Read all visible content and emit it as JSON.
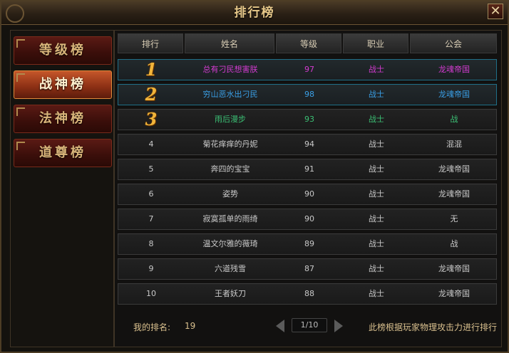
{
  "window": {
    "title": "排行榜",
    "close_label": "✕"
  },
  "sidebar": {
    "items": [
      {
        "label": "等级榜",
        "active": false
      },
      {
        "label": "战神榜",
        "active": true
      },
      {
        "label": "法神榜",
        "active": false
      },
      {
        "label": "道尊榜",
        "active": false
      }
    ]
  },
  "table": {
    "headers": [
      "排行",
      "姓名",
      "等级",
      "职业",
      "公会"
    ],
    "rows": [
      {
        "rank": "1",
        "name": "总有刁民想害朕",
        "level": "97",
        "class": "战士",
        "guild": "龙魂帝国",
        "color": "#d33bd0",
        "selected": true
      },
      {
        "rank": "2",
        "name": "穷山恶水出刁民",
        "level": "98",
        "class": "战士",
        "guild": "龙魂帝国",
        "color": "#3a9fe6",
        "selected": true
      },
      {
        "rank": "3",
        "name": "雨后漫步",
        "level": "93",
        "class": "战士",
        "guild": "战",
        "color": "#3bbf74",
        "selected": false
      },
      {
        "rank": "4",
        "name": "菊花痒痒的丹妮",
        "level": "94",
        "class": "战士",
        "guild": "混混",
        "color": "#c9c9c9",
        "selected": false
      },
      {
        "rank": "5",
        "name": "奔四的宝宝",
        "level": "91",
        "class": "战士",
        "guild": "龙魂帝国",
        "color": "#c9c9c9",
        "selected": false
      },
      {
        "rank": "6",
        "name": "姿势",
        "level": "90",
        "class": "战士",
        "guild": "龙魂帝国",
        "color": "#c9c9c9",
        "selected": false
      },
      {
        "rank": "7",
        "name": "寂寞孤单的雨绮",
        "level": "90",
        "class": "战士",
        "guild": "无",
        "color": "#c9c9c9",
        "selected": false
      },
      {
        "rank": "8",
        "name": "温文尔雅的薇琦",
        "level": "89",
        "class": "战士",
        "guild": "战",
        "color": "#c9c9c9",
        "selected": false
      },
      {
        "rank": "9",
        "name": "六道残雪",
        "level": "87",
        "class": "战士",
        "guild": "龙魂帝国",
        "color": "#c9c9c9",
        "selected": false
      },
      {
        "rank": "10",
        "name": "王者妖刀",
        "level": "88",
        "class": "战士",
        "guild": "龙魂帝国",
        "color": "#c9c9c9",
        "selected": false
      }
    ]
  },
  "footer": {
    "my_rank_label": "我的排名:",
    "my_rank_value": "19",
    "page": "1/10",
    "note": "此榜根据玩家物理攻击力进行排行"
  }
}
